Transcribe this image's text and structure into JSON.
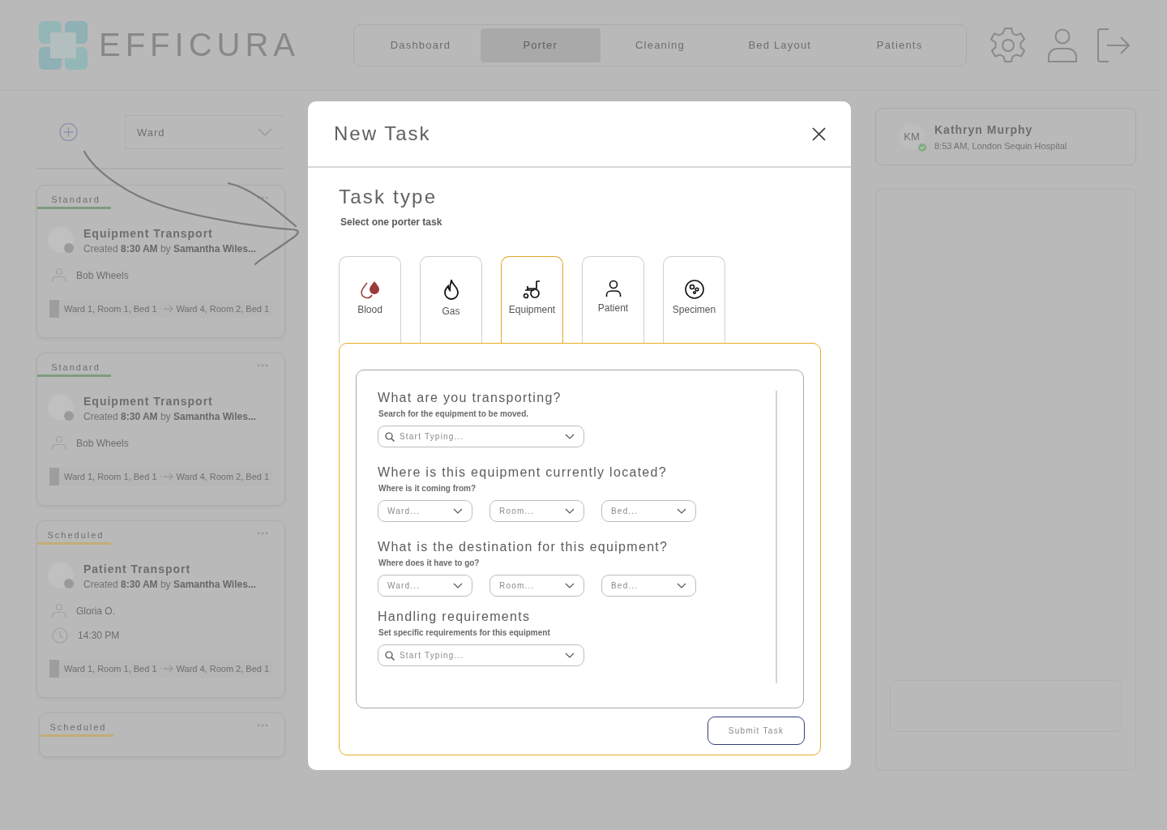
{
  "app": {
    "logo": "EFFICURA"
  },
  "nav": [
    {
      "label": "Dashboard",
      "selected": false
    },
    {
      "label": "Porter",
      "selected": true
    },
    {
      "label": "Cleaning",
      "selected": false
    },
    {
      "label": "Bed Layout",
      "selected": false
    },
    {
      "label": "Patients",
      "selected": false
    }
  ],
  "sidebar": {
    "ward_filter": {
      "placeholder": "Ward"
    },
    "tasks": [
      {
        "priority": "Standard",
        "color": "#7e9c80",
        "title": "Equipment Transport",
        "created": "Created **8:30 AM** by **Samantha Wiles...**",
        "porter": "Bob Wheels",
        "from": "Ward 1, Room 1, Bed 1",
        "to": "Ward 4, Room 2, Bed 1"
      },
      {
        "priority": "Standard",
        "color": "#7e9c80",
        "title": "Equipment Transport",
        "created": "Created **8:30 AM** by **Samantha Wiles...**",
        "porter": "Bob Wheels",
        "from": "Ward 1, Room 1, Bed 1",
        "to": "Ward 4, Room 2, Bed 1"
      },
      {
        "priority": "Scheduled",
        "color": "#c2ac78",
        "title": "Patient Transport",
        "created": "Created **8:30 AM** by **Samantha Wiles...**",
        "porter": "Gloria O.",
        "time": "14:30 PM",
        "from": "Ward 1, Room 1, Bed 1",
        "to": "Ward 4, Room 2, Bed 1"
      },
      {
        "priority": "Scheduled",
        "color": "#c2ac78"
      }
    ]
  },
  "profile": {
    "initials": "KM",
    "name": "Kathryn Murphy",
    "detail": "8:53 AM, London Sequin Hospital",
    "online": true
  },
  "modal": {
    "title": "New Task",
    "section_title": "Task type",
    "section_hint": "Select one porter task",
    "task_types": [
      {
        "kind": "blood",
        "label": "Blood",
        "selected": false
      },
      {
        "kind": "gas",
        "label": "Gas",
        "selected": false
      },
      {
        "kind": "equipment",
        "label": "Equipment",
        "selected": true
      },
      {
        "kind": "patient",
        "label": "Patient",
        "selected": false
      },
      {
        "kind": "specimen",
        "label": "Specimen",
        "selected": false
      }
    ],
    "questions": [
      {
        "title": "What are you transporting?",
        "hint": "Search for the equipment to be moved.",
        "fields": [
          {
            "kind": "search",
            "placeholder": "Start Typing..."
          }
        ]
      },
      {
        "title": "Where is this equipment currently located?",
        "hint": "Where is it coming from?",
        "fields": [
          {
            "kind": "select",
            "placeholder": "Ward..."
          },
          {
            "kind": "select",
            "placeholder": "Room..."
          },
          {
            "kind": "select",
            "placeholder": "Bed..."
          }
        ]
      },
      {
        "title": "What is the destination for this equipment?",
        "hint": "Where does it have to go?",
        "fields": [
          {
            "kind": "select",
            "placeholder": "Ward..."
          },
          {
            "kind": "select",
            "placeholder": "Room..."
          },
          {
            "kind": "select",
            "placeholder": "Bed..."
          }
        ]
      },
      {
        "title": "Handling requirements",
        "hint": "Set specific requirements for this equipment",
        "fields": [
          {
            "kind": "search",
            "placeholder": "Start Typing..."
          }
        ]
      }
    ],
    "submit": "Submit Task"
  }
}
